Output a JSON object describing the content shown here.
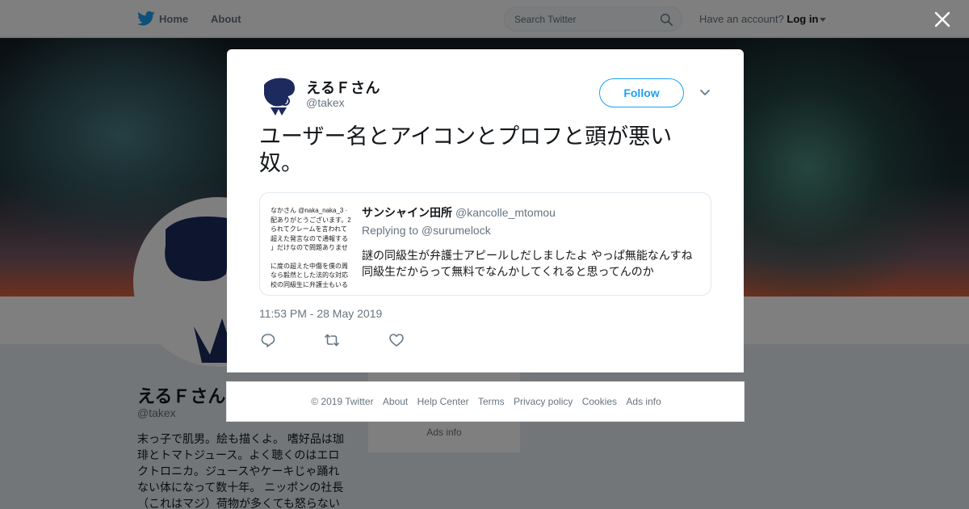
{
  "topbar": {
    "home_label": "Home",
    "about_label": "About",
    "search_placeholder": "Search Twitter",
    "account_prefix": "Have an account?",
    "login_label": "Log in"
  },
  "profile": {
    "name": "えるＦさん",
    "handle": "@takex",
    "bio": "末っ子で肌男。絵も描くよ。 嗜好品は珈琲とトマトジュース。よく聴くのはエロクトロニカ。ジュースやケーキじゃ踊れない体になって数十年。 ニッポンの社長（これはマジ）荷物が多くても怒らない",
    "side_ads": "Ads info"
  },
  "tweet": {
    "author_name": "えるＦさん",
    "author_handle": "@takex",
    "follow_label": "Follow",
    "text": "ユーザー名とアイコンとプロフと頭が悪い奴。",
    "timestamp": "11:53 PM - 28 May 2019",
    "quote": {
      "name": "サンシャイン田所",
      "handle": "@kancolle_mtomou",
      "replying_to": "Replying to @surumelock",
      "body_line1": "謎の同級生が弁護士アピールしだしましたよ やっぱ無能なんすね",
      "body_line2": "同級生だからって無料でなんかしてくれると思ってんのか",
      "thumb_lines": [
        "なかさん @naka_naka_3 · ",
        "配ありがとうございます。2",
        "られてクレームを言われて",
        "超えた発言なので通報する",
        "」だけなので問題ありませ",
        "に度の超えた中傷を僕の周",
        "なら毅然とした法的な対応",
        "校の同級生に弁護士もいる"
      ]
    }
  },
  "footer": {
    "copyright": "© 2019 Twitter",
    "about": "About",
    "help": "Help Center",
    "terms": "Terms",
    "privacy": "Privacy policy",
    "cookies": "Cookies",
    "ads": "Ads info"
  },
  "colors": {
    "brand": "#1da1f2",
    "text": "#14171a",
    "muted": "#66757f",
    "avatar_navy": "#1c2a5e"
  }
}
